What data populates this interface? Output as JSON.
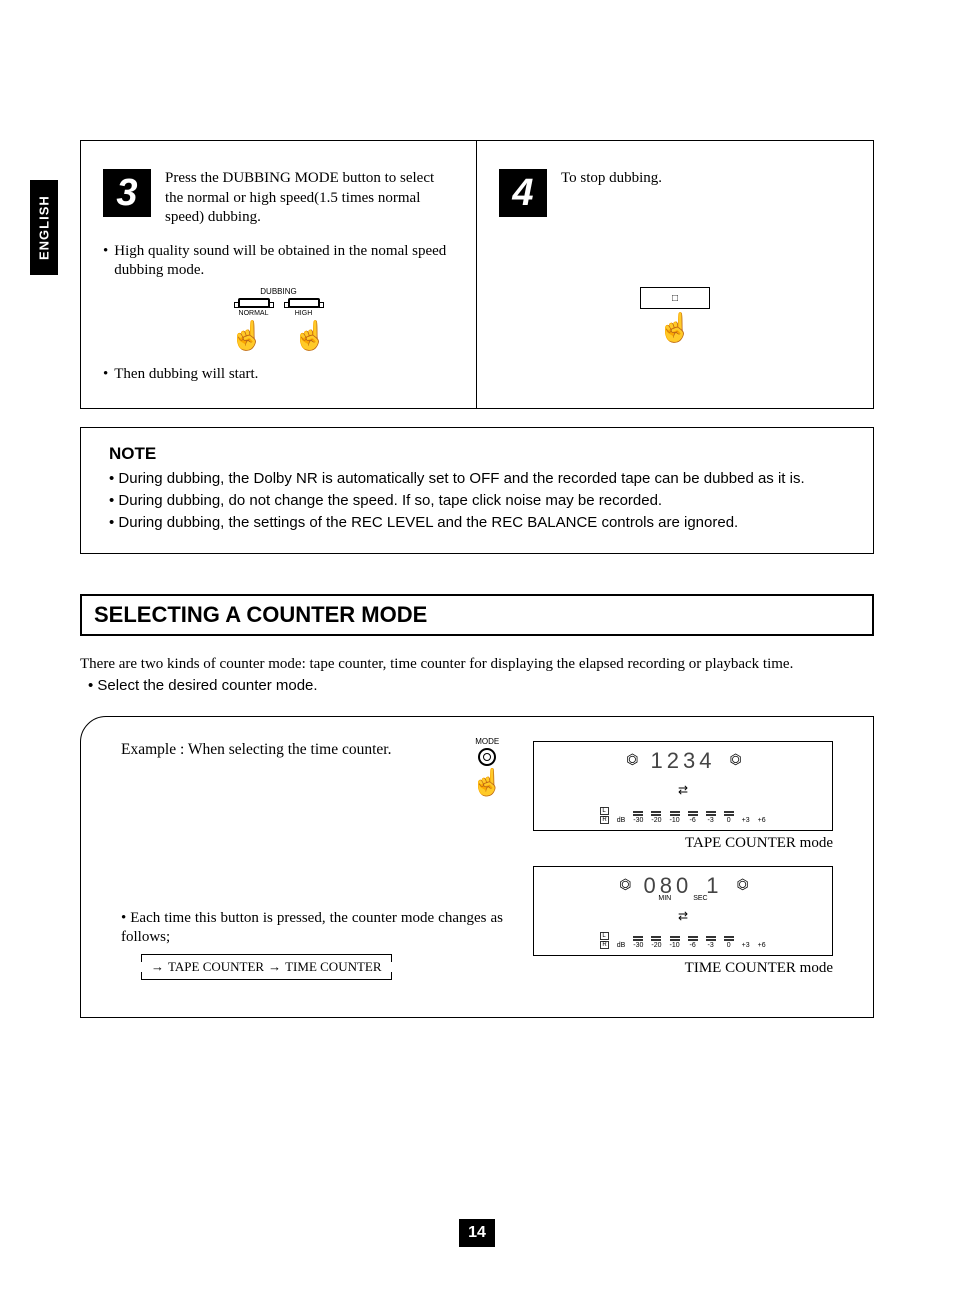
{
  "lang_tab": "ENGLISH",
  "page_number": "14",
  "step3": {
    "num": "3",
    "text": "Press the DUBBING MODE button to select the normal or high speed(1.5 times normal speed) dubbing.",
    "bullet1": "High quality sound will be obtained in the nomal speed dubbing mode.",
    "bullet2": "Then dubbing will start.",
    "diagram": {
      "top_label": "DUBBING",
      "left_label": "NORMAL",
      "right_label": "HIGH"
    }
  },
  "step4": {
    "num": "4",
    "text": "To stop dubbing."
  },
  "note": {
    "title": "NOTE",
    "items": [
      "During dubbing, the Dolby NR is automatically set to OFF and the recorded tape can be dubbed as it is.",
      "During dubbing, do not change the speed. If so, tape click noise may be recorded.",
      "During dubbing, the settings of the REC LEVEL and the REC BALANCE controls are ignored."
    ]
  },
  "section_title": "SELECTING A COUNTER MODE",
  "intro": "There are two kinds of counter mode: tape counter, time counter for displaying the elapsed recording or playback time.",
  "intro_bullet": "Select the desired counter mode.",
  "example": {
    "heading": "Example : When  selecting the time counter.",
    "mode_label": "MODE",
    "seq_text": "Each time this button is pressed, the counter mode changes as follows;",
    "seq_item1": "TAPE COUNTER",
    "seq_item2": "TIME COUNTER",
    "tape_display": "1234",
    "tape_caption": "TAPE COUNTER mode",
    "time_display_min": "080",
    "time_display_sec": "1",
    "min_label": "MIN",
    "sec_label": "SEC",
    "time_caption": "TIME COUNTER mode",
    "meter_ticks": [
      "-30",
      "-20",
      "-10",
      "-6",
      "-3",
      "0",
      "+3",
      "+6"
    ],
    "lr_label_l": "L",
    "lr_label_r": "R",
    "db_label": "dB",
    "direction": "⇄"
  }
}
